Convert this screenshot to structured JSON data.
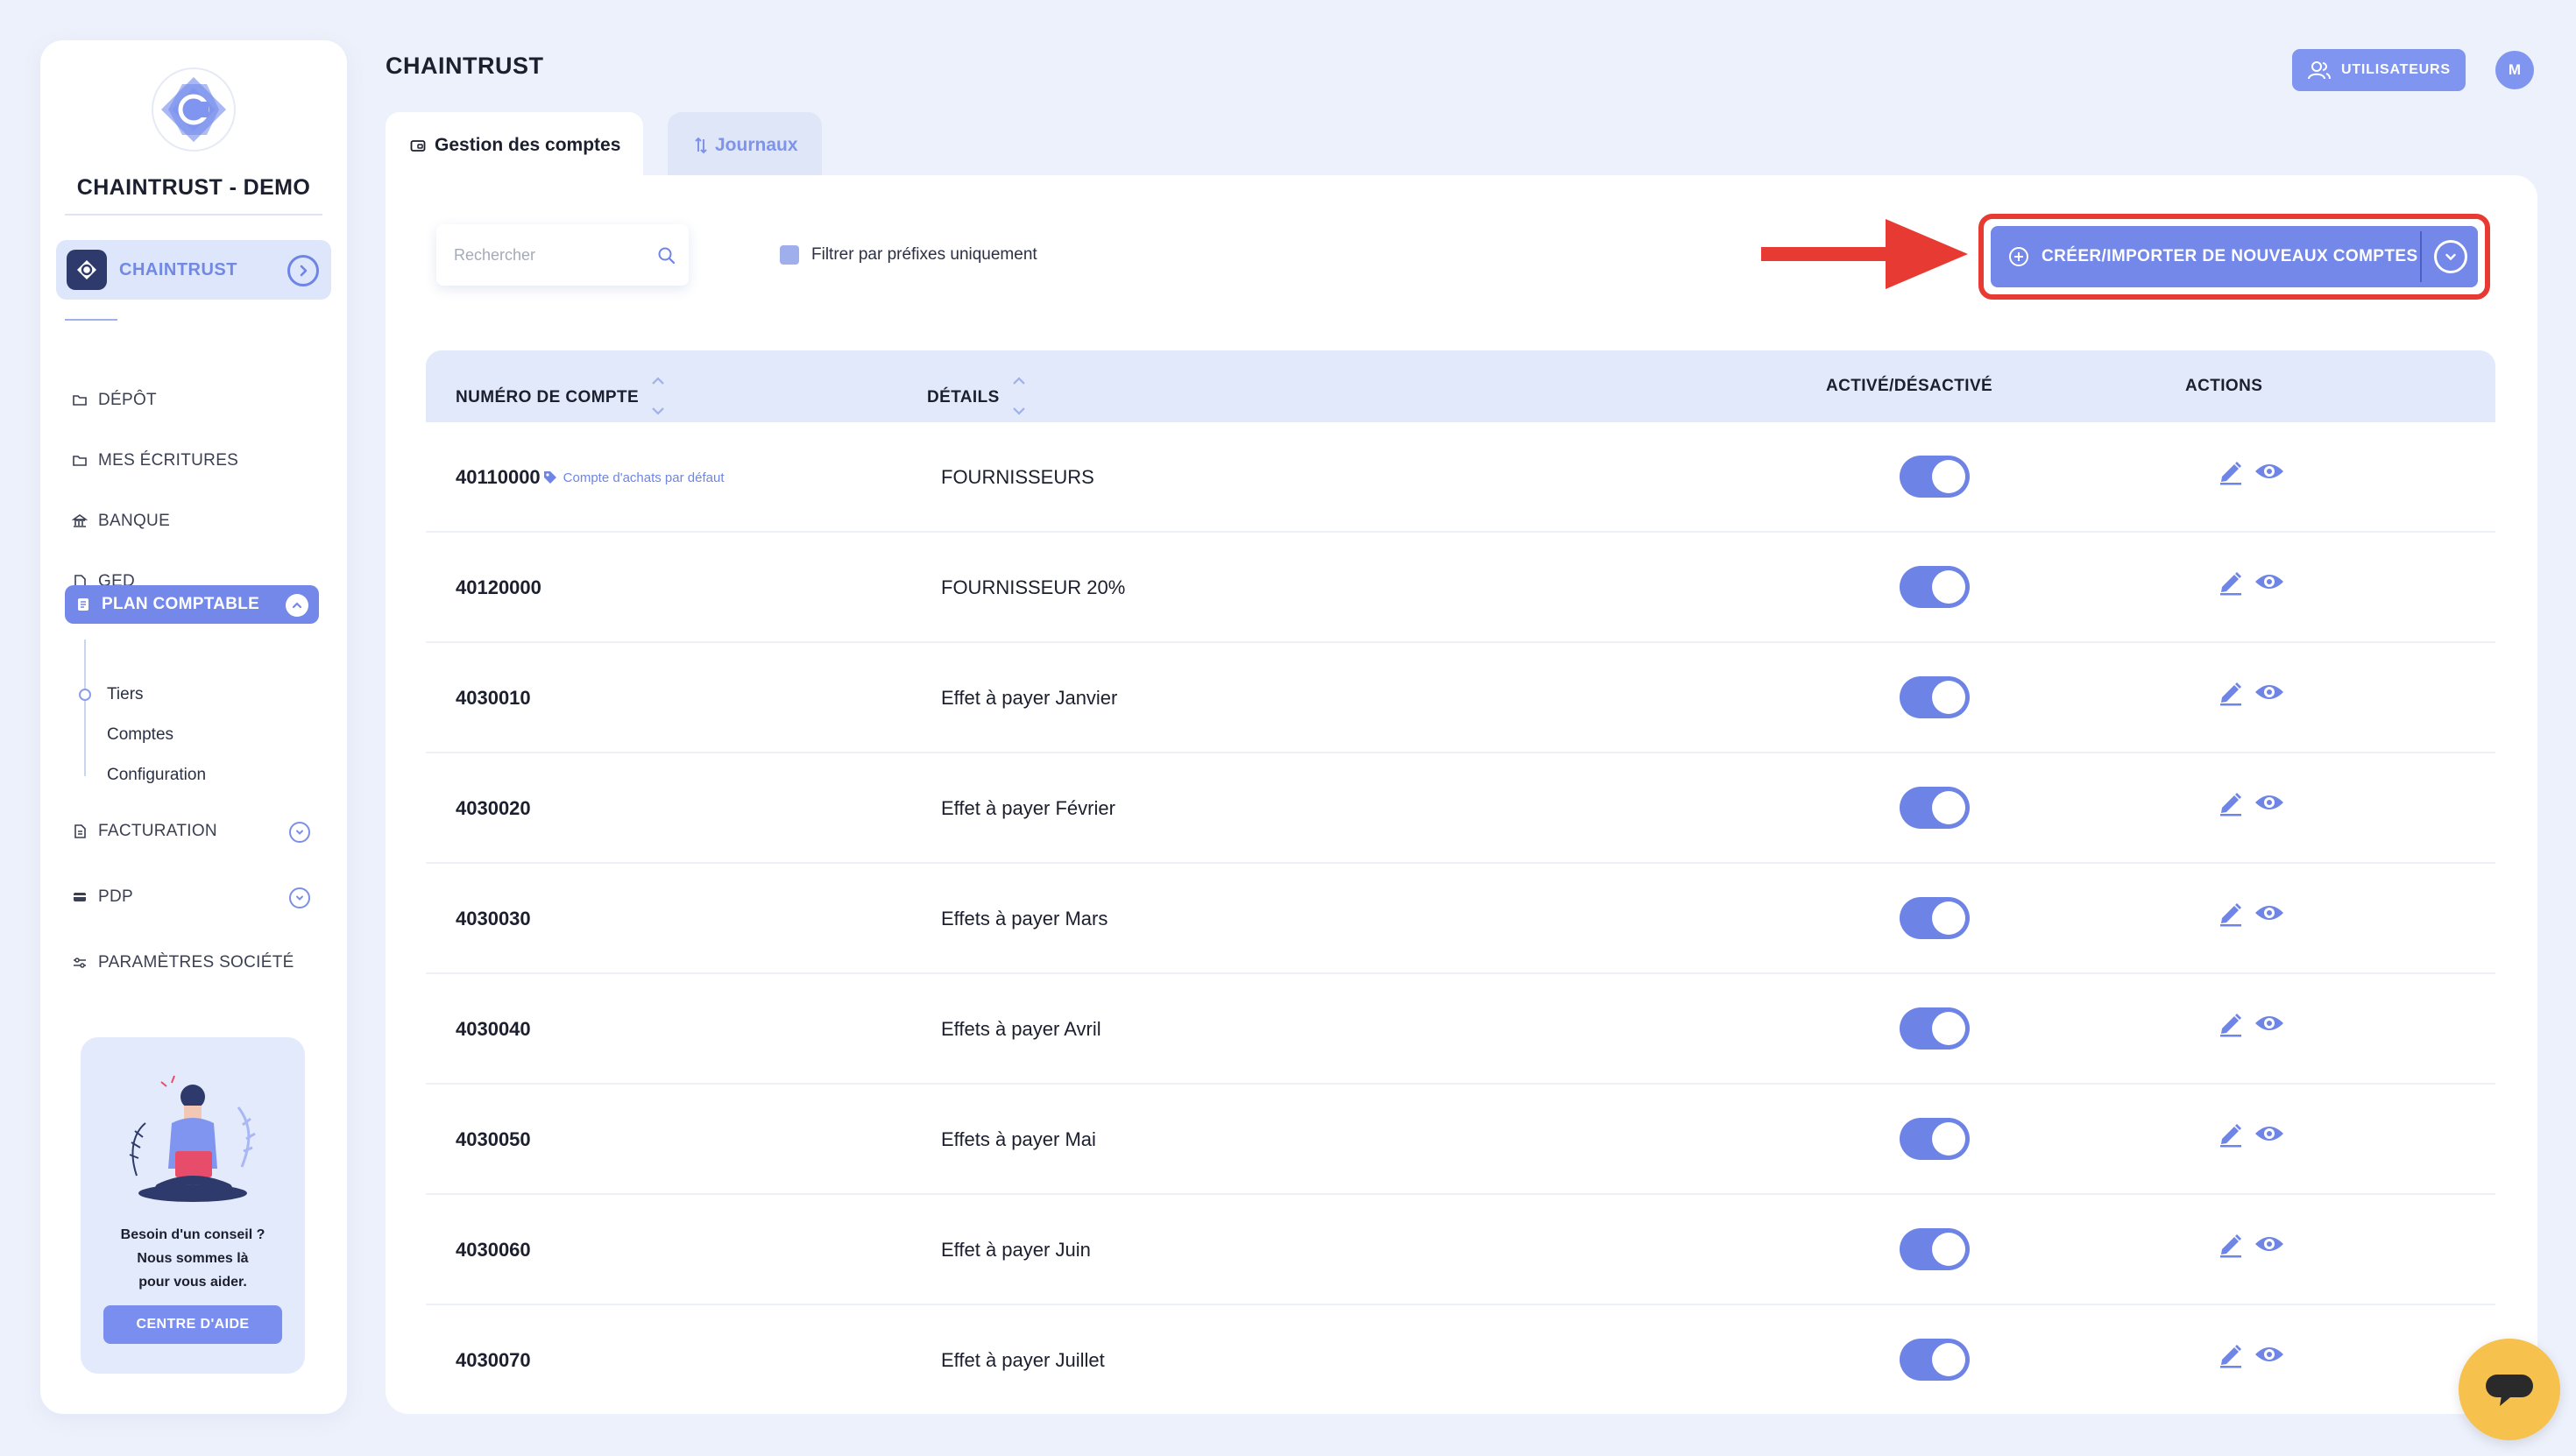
{
  "sidebar": {
    "brand": "CHAINTRUST - DEMO",
    "company": "CHAINTRUST",
    "nav": {
      "depot": "DÉPÔT",
      "ecritures": "MES ÉCRITURES",
      "banque": "BANQUE",
      "ged": "GED",
      "plan": "PLAN COMPTABLE",
      "facturation": "FACTURATION",
      "pdp": "PDP",
      "parametres": "PARAMÈTRES SOCIÉTÉ"
    },
    "subnav": [
      "Tiers",
      "Comptes",
      "Configuration"
    ],
    "help": {
      "line1": "Besoin d'un conseil ?",
      "line2": "Nous sommes là",
      "line3": "pour vous aider.",
      "button": "CENTRE D'AIDE"
    }
  },
  "header": {
    "title": "CHAINTRUST",
    "users_button": "UTILISATEURS",
    "avatar_initial": "M"
  },
  "tabs": [
    {
      "label": "Gestion des comptes",
      "active": true
    },
    {
      "label": "Journaux",
      "active": false
    }
  ],
  "toolbar": {
    "search_placeholder": "Rechercher",
    "filter_label": "Filtrer par préfixes uniquement",
    "create_button": "CRÉER/IMPORTER DE NOUVEAUX COMPTES"
  },
  "table": {
    "columns": [
      "NUMÉRO DE COMPTE",
      "DÉTAILS",
      "ACTIVÉ/DÉSACTIVÉ",
      "ACTIONS"
    ],
    "rows": [
      {
        "account": "40110000",
        "badge": "Compte d'achats par défaut",
        "details": "FOURNISSEURS",
        "active": true
      },
      {
        "account": "40120000",
        "badge": "",
        "details": "FOURNISSEUR 20%",
        "active": true
      },
      {
        "account": "4030010",
        "badge": "",
        "details": "Effet à payer Janvier",
        "active": true
      },
      {
        "account": "4030020",
        "badge": "",
        "details": "Effet à payer Février",
        "active": true
      },
      {
        "account": "4030030",
        "badge": "",
        "details": "Effets à payer Mars",
        "active": true
      },
      {
        "account": "4030040",
        "badge": "",
        "details": "Effets à payer Avril",
        "active": true
      },
      {
        "account": "4030050",
        "badge": "",
        "details": "Effets à payer Mai",
        "active": true
      },
      {
        "account": "4030060",
        "badge": "",
        "details": "Effet à payer Juin",
        "active": true
      },
      {
        "account": "4030070",
        "badge": "",
        "details": "Effet à payer Juillet",
        "active": true
      }
    ]
  },
  "colors": {
    "accent": "#7388e8",
    "background": "#edf1fb",
    "highlight": "#e73a32",
    "chat": "#f6c14d"
  }
}
